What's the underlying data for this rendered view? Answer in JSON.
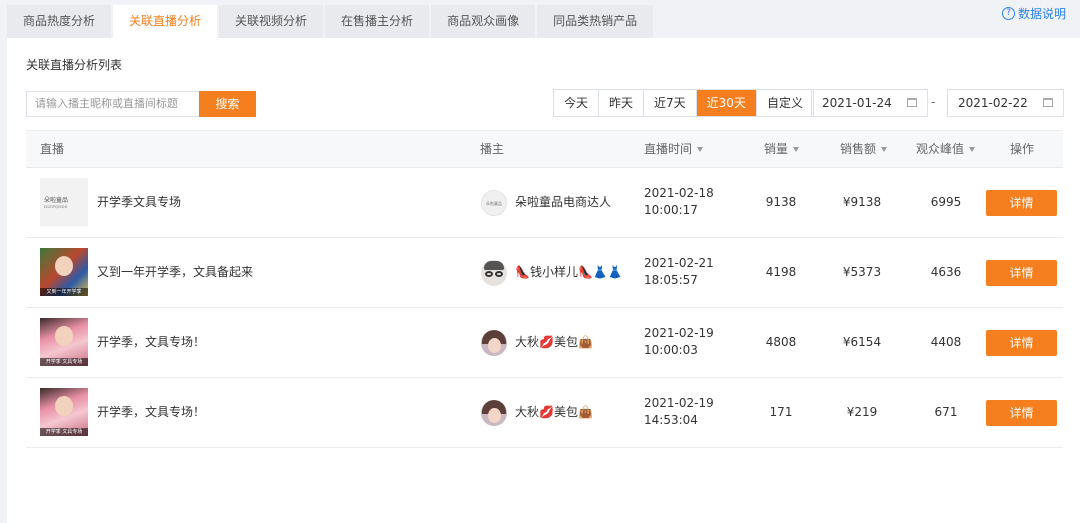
{
  "tabs": [
    {
      "label": "商品热度分析",
      "active": false
    },
    {
      "label": "关联直播分析",
      "active": true
    },
    {
      "label": "关联视频分析",
      "active": false
    },
    {
      "label": "在售播主分析",
      "active": false
    },
    {
      "label": "商品观众画像",
      "active": false
    },
    {
      "label": "同品类热销产品",
      "active": false
    }
  ],
  "help_label": "数据说明",
  "help_icon_glyph": "?",
  "panel_title": "关联直播分析列表",
  "search": {
    "placeholder": "请输入播主昵称或直播间标题",
    "button_label": "搜索"
  },
  "ranges": [
    {
      "label": "今天",
      "active": false
    },
    {
      "label": "昨天",
      "active": false
    },
    {
      "label": "近7天",
      "active": false
    },
    {
      "label": "近30天",
      "active": true
    },
    {
      "label": "自定义",
      "active": false
    }
  ],
  "date_start": "2021-01-24",
  "date_end": "2021-02-22",
  "date_separator": "-",
  "columns": [
    "直播",
    "播主",
    "直播时间",
    "销量",
    "销售额",
    "观众峰值",
    "操作"
  ],
  "rows": [
    {
      "title": "开学季文具专场",
      "anchor": "朵啦童品电商达人",
      "date": "2021-02-18",
      "time": "10:00:17",
      "sales": "9138",
      "revenue": "¥9138",
      "peak": "6995",
      "action": "详情",
      "cover_text": "朵啦童品",
      "cover_sub": "DLTPQDDS",
      "avatar_text": "朵啦童品"
    },
    {
      "title": "又到一年开学季，文具备起来",
      "anchor": "👠钱小样儿👠👗👗",
      "date": "2021-02-21",
      "time": "18:05:57",
      "sales": "4198",
      "revenue": "¥5373",
      "peak": "4636",
      "action": "详情",
      "cover_strip": "又到一年开学季"
    },
    {
      "title": "开学季，文具专场！",
      "anchor": "大秋💋美包👜",
      "date": "2021-02-19",
      "time": "10:00:03",
      "sales": "4808",
      "revenue": "¥6154",
      "peak": "4408",
      "action": "详情",
      "cover_strip": "开学季 文具专场"
    },
    {
      "title": "开学季，文具专场！",
      "anchor": "大秋💋美包👜",
      "date": "2021-02-19",
      "time": "14:53:04",
      "sales": "171",
      "revenue": "¥219",
      "peak": "671",
      "action": "详情",
      "cover_strip": "开学季 文具专场"
    }
  ],
  "colors": {
    "accent": "#f57f1f",
    "link": "#2b83f6"
  }
}
